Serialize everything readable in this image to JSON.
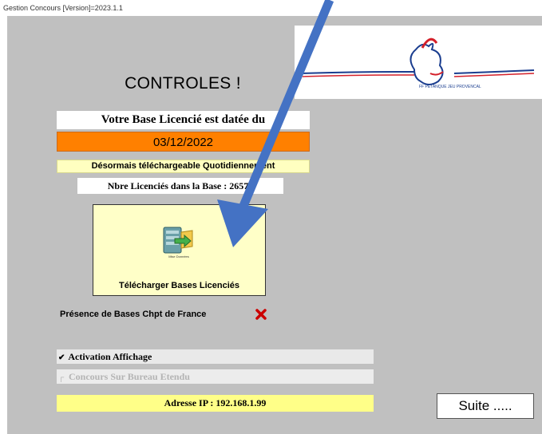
{
  "window": {
    "title": "Gestion Concours [Version]=2023.1.1"
  },
  "page": {
    "title": "CONTROLES !"
  },
  "logo": {
    "text": "FF PETANQUE JEU PROVENCAL"
  },
  "base": {
    "date_label": "Votre Base Licencié est datée du",
    "date_value": "03/12/2022",
    "daily_notice": "Désormais téléchargeable Quotidiennement",
    "count_label": "Nbre Licenciés dans la Base : 26572"
  },
  "download": {
    "label": "Télécharger Bases Licenciés",
    "icon_caption": "Mise Données",
    "icon": "database-download-icon"
  },
  "presence": {
    "label": "Présence de Bases Chpt de France",
    "status_icon": "red-x-icon",
    "status_color": "#cc0000"
  },
  "options": {
    "activation": {
      "label": "Activation Affichage",
      "checked": true
    },
    "concours_bureau": {
      "label": "Concours Sur Bureau Etendu",
      "checked": false,
      "enabled": false
    }
  },
  "network": {
    "ip_label": "Adresse IP : 192.168.1.99"
  },
  "actions": {
    "suite_label": "Suite ....."
  },
  "annotation": {
    "arrow_color": "#4472c4"
  },
  "colors": {
    "background": "#c0c0c0",
    "date_bg": "#ff8000",
    "notice_bg": "#ffffc0",
    "ip_bg": "#ffff88"
  }
}
